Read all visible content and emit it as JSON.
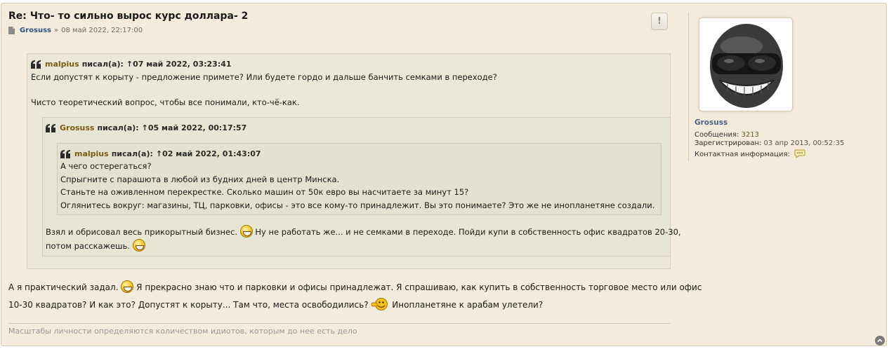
{
  "post": {
    "title": "Re: Что- то сильно вырос курс доллара- 2",
    "author": "Grosuss",
    "separator": "»",
    "date": "08 май 2022, 22:17:00",
    "report_label": "!"
  },
  "quotes": {
    "q1": {
      "author": "malpius",
      "said": "писал(а):",
      "arrow": "↑",
      "date": "07 май 2022, 03:23:41",
      "lines": [
        "Если допустят к корыту - предложение примете? Или будете гордо и дальше банчить семками в переходе?",
        "Чисто теоретический вопрос, чтобы все понимали, кто-чё-как."
      ]
    },
    "q2": {
      "author": "Grosuss",
      "said": "писал(а):",
      "arrow": "↑",
      "date": "05 май 2022, 00:17:57",
      "text_part1": "Взял и обрисовал весь прикорытный бизнес.",
      "text_part2": "Ну не работать же... и не семками в переходе. Пойди купи в собственность офис квадратов 20-30,",
      "text_part3": "потом расскажешь."
    },
    "q3": {
      "author": "malpius",
      "said": "писал(а):",
      "arrow": "↑",
      "date": "02 май 2022, 01:43:07",
      "lines": [
        "А чего остерегаться?",
        "Спрыгните с парашюта в любой из будних дней в центр Минска.",
        "Станьте на оживленном перекрестке. Сколько машин от 50к евро вы насчитаете за минут 15?",
        "Оглянитесь вокруг: магазины, ТЦ, парковки, офисы - это все кому-то принадлежит. Вы это понимаете? Это же не инопланетяне создали."
      ]
    }
  },
  "body": {
    "part1": "А я практический задал.",
    "part2": "Я прекрасно знаю что и парковки и офисы принадлежат. Я спрашиваю, как купить в собственность торговое место или офис",
    "part3": "10-30 квадратов? И как это? Допустят к корыту... Там что, места освободились?",
    "part4": "Инопланетяне к арабам улетели?"
  },
  "signature": "Масштабы личности определяются количеством идиотов, которым до нее есть дело",
  "profile": {
    "name": "Grosuss",
    "messages_label": "Сообщения:",
    "messages_value": "3213",
    "registered_label": "Зарегистрирован:",
    "registered_value": "03 апр 2013, 00:52:35",
    "contact_label": "Контактная информация:"
  },
  "colors": {
    "post_bg": "#f3ecdc",
    "quote_bg": "#ebe8d9",
    "author_link": "#2f4f7f",
    "quote_author": "#7a5b10"
  }
}
